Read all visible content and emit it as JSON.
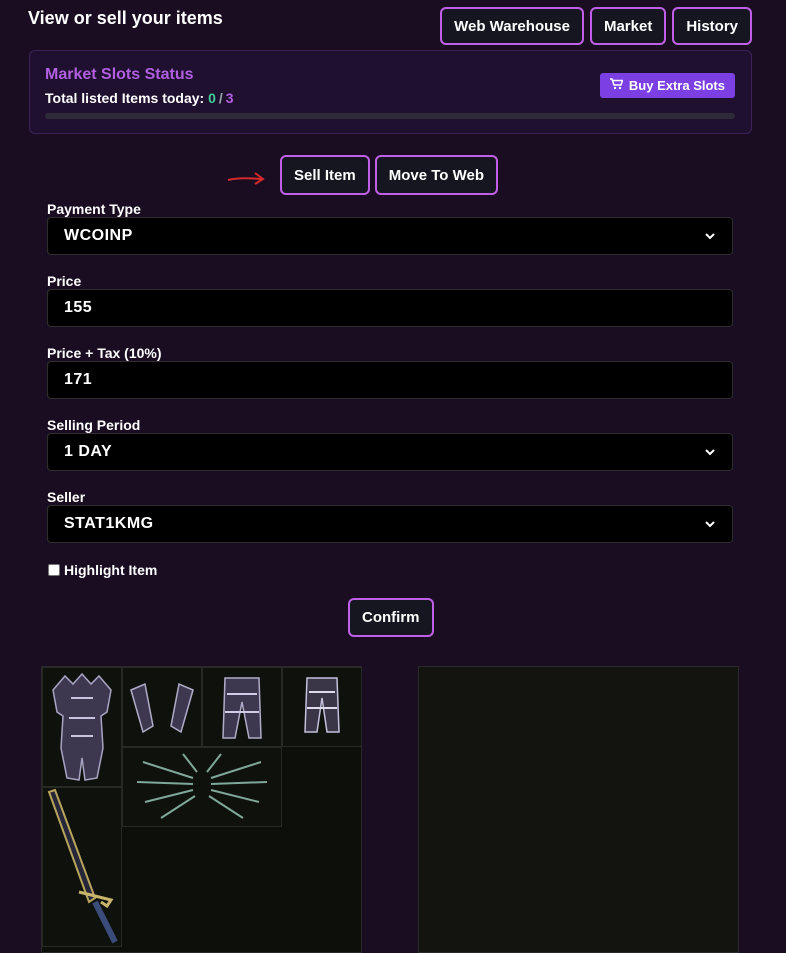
{
  "header": {
    "title": "View or sell your items",
    "nav": [
      "Web Warehouse",
      "Market",
      "History"
    ]
  },
  "slots": {
    "title": "Market Slots Status",
    "subtitle": "Total listed Items today:",
    "current": "0",
    "separator": "/",
    "max": "3",
    "progress_fraction": 0,
    "buy_label": "Buy Extra Slots",
    "buy_icon": "cart-icon"
  },
  "tabs": {
    "sell": "Sell Item",
    "move": "Move To Web"
  },
  "form": {
    "payment_label": "Payment Type",
    "payment_value": "WCOINP",
    "price_label": "Price",
    "price_value": "155",
    "tax_label": "Price + Tax (10%)",
    "tax_value": "171",
    "period_label": "Selling Period",
    "period_value": "1 DAY",
    "seller_label": "Seller",
    "seller_value": "STAT1KMG",
    "highlight_label": "Highlight Item",
    "highlight_checked": false,
    "confirm_label": "Confirm"
  },
  "warehouse_items": [
    "armor",
    "gloves",
    "pants",
    "boots",
    "wings",
    "sword"
  ],
  "colors": {
    "accent": "#b15fe0",
    "button_border": "#c060e8",
    "buy_button": "#7b3fe4",
    "count_current": "#3fcf9a",
    "background": "#1a0d22"
  }
}
